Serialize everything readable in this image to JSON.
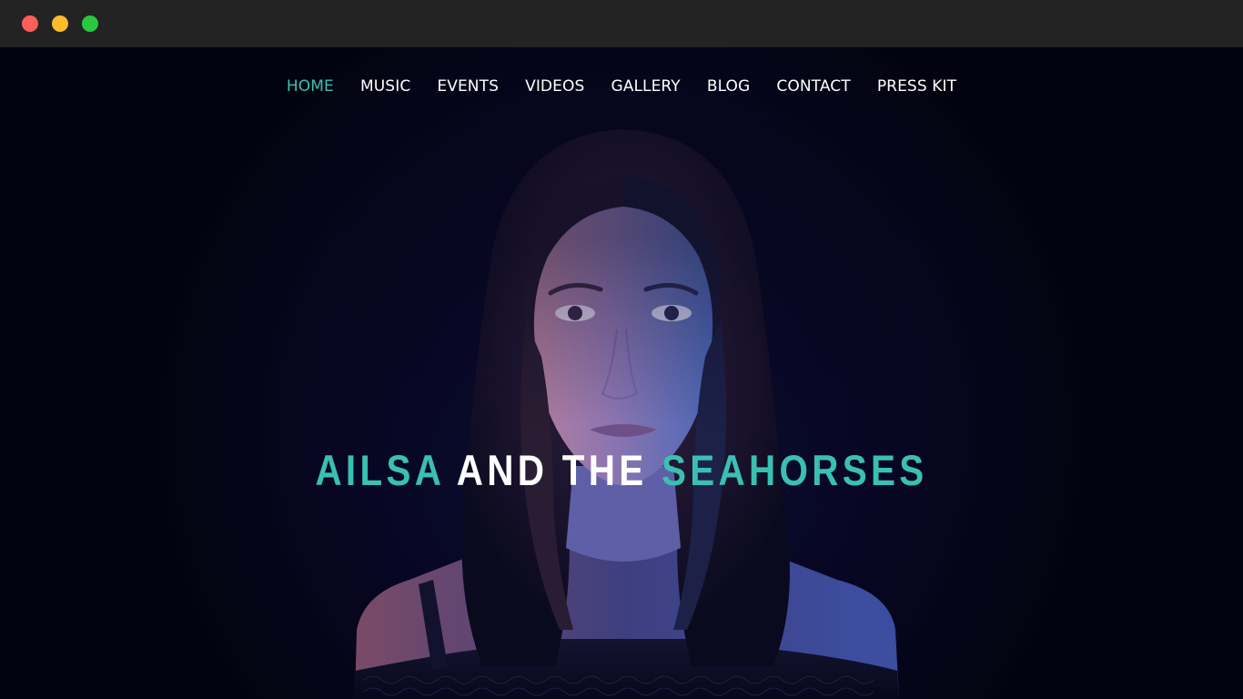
{
  "window": {
    "controls": [
      "close",
      "minimize",
      "maximize"
    ]
  },
  "nav": {
    "items": [
      {
        "label": "HOME",
        "active": true
      },
      {
        "label": "MUSIC",
        "active": false
      },
      {
        "label": "EVENTS",
        "active": false
      },
      {
        "label": "VIDEOS",
        "active": false
      },
      {
        "label": "GALLERY",
        "active": false
      },
      {
        "label": "BLOG",
        "active": false
      },
      {
        "label": "CONTACT",
        "active": false
      },
      {
        "label": "PRESS KIT",
        "active": false
      }
    ]
  },
  "hero": {
    "title_part1": "AILSA",
    "title_part2": " AND THE ",
    "title_part3": "SEAHORSES",
    "image": "portrait-photo"
  },
  "colors": {
    "accent": "#3ac0b3",
    "background": "#05051a",
    "titlebar": "#232323"
  }
}
